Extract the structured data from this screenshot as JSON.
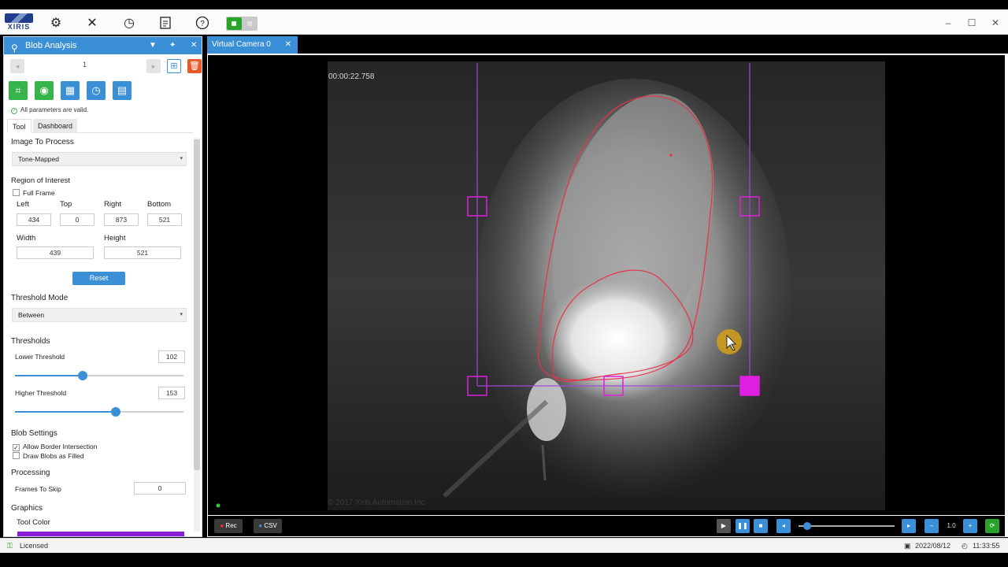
{
  "topbar": {
    "logo_text": "XIRIS",
    "icons": [
      "gear-icon",
      "tools-icon",
      "gauge-icon",
      "document-icon",
      "help-icon"
    ],
    "window_controls": {
      "minimize": "‒",
      "maximize": "☐",
      "close": "✕"
    }
  },
  "panel": {
    "title": "Blob Analysis",
    "page_number": "1",
    "valid_text": "All parameters are valid.",
    "tabs": [
      "Tool",
      "Dashboard"
    ],
    "image_to_process": {
      "label": "Image To Process",
      "value": "Tone-Mapped"
    },
    "roi": {
      "label": "Region of Interest",
      "full_frame_label": "Full Frame",
      "full_frame_checked": false,
      "left_label": "Left",
      "left": "434",
      "top_label": "Top",
      "top": "0",
      "right_label": "Right",
      "right": "873",
      "bottom_label": "Bottom",
      "bottom": "521",
      "width_label": "Width",
      "width": "439",
      "height_label": "Height",
      "height": "521",
      "reset_label": "Reset"
    },
    "threshold_mode": {
      "label": "Threshold Mode",
      "value": "Between"
    },
    "thresholds": {
      "label": "Thresholds",
      "lower_label": "Lower Threshold",
      "lower": "102",
      "lower_fraction": 0.4,
      "higher_label": "Higher Threshold",
      "higher": "153",
      "higher_fraction": 0.6
    },
    "blob_settings": {
      "label": "Blob Settings",
      "allow_border_label": "Allow Border Intersection",
      "allow_border_checked": true,
      "draw_filled_label": "Draw Blobs as Filled",
      "draw_filled_checked": false
    },
    "processing": {
      "label": "Processing",
      "frames_to_skip_label": "Frames To Skip",
      "frames_to_skip": "0"
    },
    "graphics": {
      "label": "Graphics",
      "tool_color_label": "Tool Color",
      "tool_color": "#8a1ed6"
    }
  },
  "camera": {
    "tab_label": "Virtual Camera 0",
    "timestamp": "00:00:22.758",
    "copyright": "© 2017 Xiris Automation Inc",
    "rec_label": "Rec",
    "csv_label": "CSV",
    "speed": "1.0"
  },
  "status": {
    "license": "Licensed",
    "date": "2022/08/12",
    "time": "11:33:55"
  },
  "colors": {
    "accent": "#3a8fd6",
    "roi_handle": "#e020e0",
    "blob_outline": "#e8324a"
  }
}
